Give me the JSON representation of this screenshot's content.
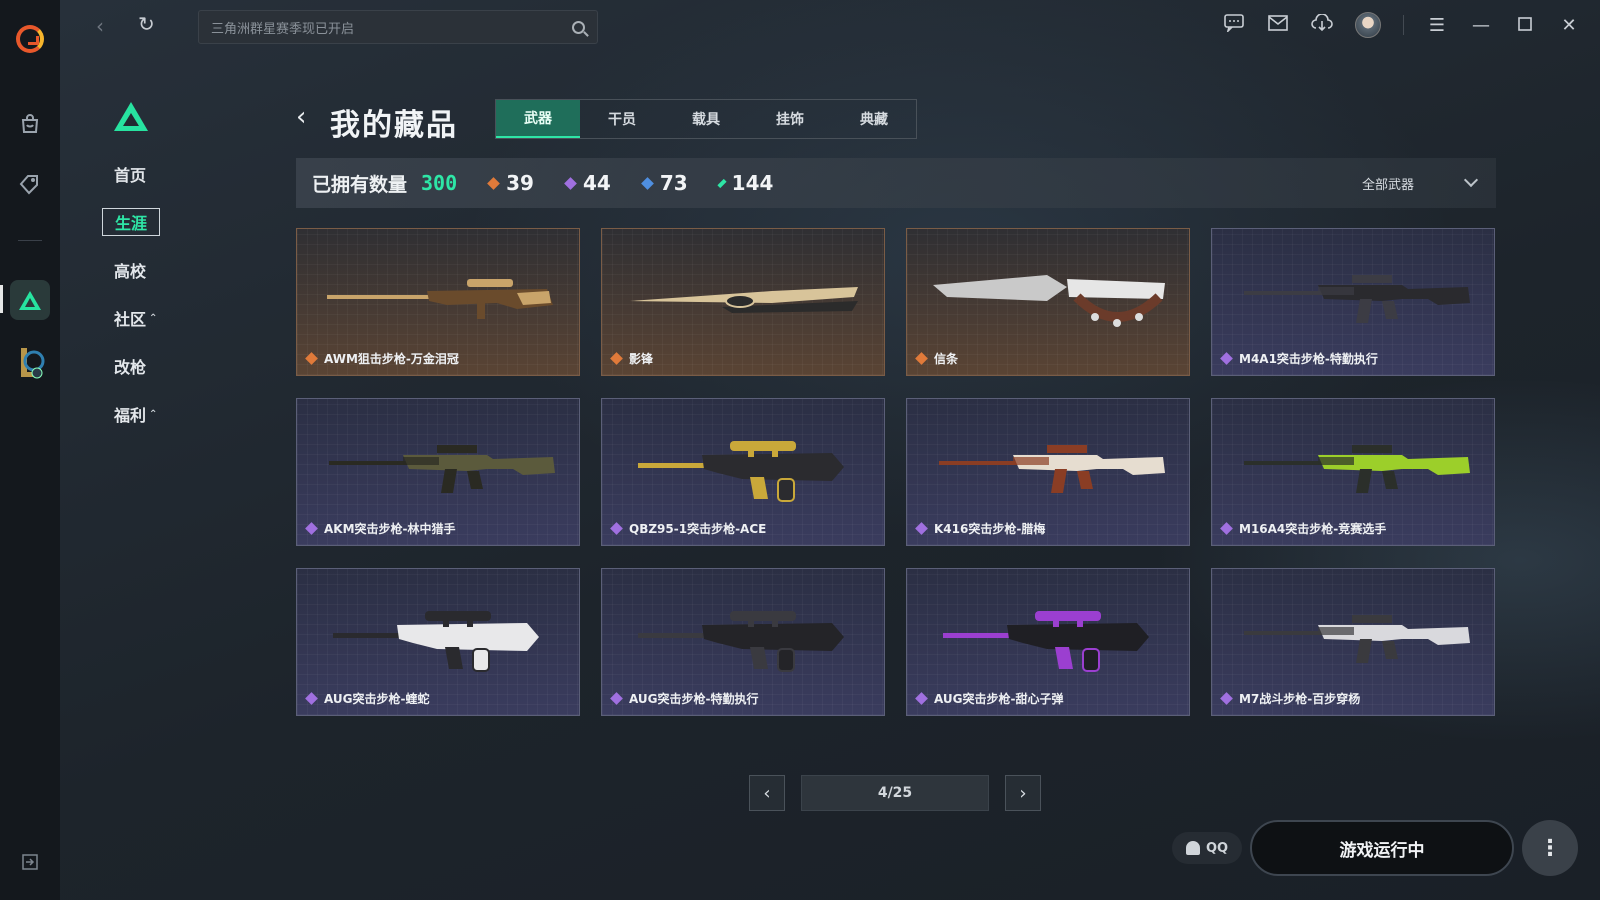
{
  "search": {
    "placeholder": "三角洲群星赛季现已开启"
  },
  "secondary_nav": {
    "items": [
      {
        "label": "首页",
        "caret": ""
      },
      {
        "label": "生涯",
        "caret": ""
      },
      {
        "label": "高校",
        "caret": ""
      },
      {
        "label": "社区",
        "caret": "^"
      },
      {
        "label": "改枪",
        "caret": ""
      },
      {
        "label": "福利",
        "caret": "^"
      }
    ],
    "active_index": 1
  },
  "header": {
    "title": "我的藏品"
  },
  "tabs": [
    "武器",
    "干员",
    "载具",
    "挂饰",
    "典藏"
  ],
  "active_tab": 0,
  "stats": {
    "owned_label": "已拥有数量",
    "owned_value": "300",
    "counts": [
      {
        "value": "39",
        "color": "#e07a3a"
      },
      {
        "value": "44",
        "color": "#a070e0"
      },
      {
        "value": "73",
        "color": "#4f8fe0"
      },
      {
        "value": "144",
        "color": "#2ee6a6"
      }
    ],
    "filter_label": "全部武器"
  },
  "items": [
    {
      "name": "AWM狙击步枪-万金泪冠",
      "rarity": "gold",
      "gem_color": "#e07a3a",
      "gun": "sniper",
      "palette": [
        "#c9a46a",
        "#6a4b2c"
      ]
    },
    {
      "name": "影锋",
      "rarity": "gold",
      "gem_color": "#e07a3a",
      "gun": "blade",
      "palette": [
        "#d8c49a",
        "#2b2b2b"
      ]
    },
    {
      "name": "信条",
      "rarity": "gold",
      "gem_color": "#e07a3a",
      "gun": "knife",
      "palette": [
        "#c9c9c9",
        "#6b3b2a"
      ]
    },
    {
      "name": "M4A1突击步枪-特勤执行",
      "rarity": "purple",
      "gem_color": "#a070e0",
      "gun": "rifle",
      "palette": [
        "#2a2a2e",
        "#3c3c44"
      ]
    },
    {
      "name": "AKM突击步枪-林中猎手",
      "rarity": "purple",
      "gem_color": "#a070e0",
      "gun": "rifle",
      "palette": [
        "#5b5a3c",
        "#2a2a22"
      ]
    },
    {
      "name": "QBZ95-1突击步枪-ACE",
      "rarity": "purple",
      "gem_color": "#a070e0",
      "gun": "bullpup",
      "palette": [
        "#2b2b2f",
        "#c9a83a"
      ]
    },
    {
      "name": "K416突击步枪-腊梅",
      "rarity": "purple",
      "gem_color": "#a070e0",
      "gun": "rifle",
      "palette": [
        "#e6ddd0",
        "#8a3d24"
      ]
    },
    {
      "name": "M16A4突击步枪-竞赛选手",
      "rarity": "purple",
      "gem_color": "#a070e0",
      "gun": "rifle",
      "palette": [
        "#9ccf2a",
        "#2b2f2a"
      ]
    },
    {
      "name": "AUG突击步枪-蝰蛇",
      "rarity": "purple",
      "gem_color": "#a070e0",
      "gun": "bullpup",
      "palette": [
        "#e8e8ea",
        "#2a2a2e"
      ]
    },
    {
      "name": "AUG突击步枪-特勤执行",
      "rarity": "purple",
      "gem_color": "#a070e0",
      "gun": "bullpup",
      "palette": [
        "#242428",
        "#3a3a40"
      ]
    },
    {
      "name": "AUG突击步枪-甜心子弹",
      "rarity": "purple",
      "gem_color": "#a070e0",
      "gun": "bullpup",
      "palette": [
        "#1f1f24",
        "#9b3fd0"
      ]
    },
    {
      "name": "M7战斗步枪-百步穿杨",
      "rarity": "purple",
      "gem_color": "#a070e0",
      "gun": "rifle",
      "palette": [
        "#d9d9dd",
        "#3a3a3e"
      ]
    }
  ],
  "pagination": {
    "current": "4/25"
  },
  "bottom": {
    "qq_label": "QQ",
    "launch_label": "游戏运行中"
  },
  "icons": {
    "rail": [
      "app-logo-icon",
      "bag-icon",
      "tag-icon",
      "delta-force-icon",
      "league-icon",
      "collapse-icon"
    ],
    "top": [
      "chat-icon",
      "mail-icon",
      "download-icon",
      "avatar",
      "menu-icon",
      "minimize-icon",
      "maximize-icon",
      "close-icon"
    ]
  },
  "colors": {
    "accent": "#2ee6a6",
    "gold": "#e07a3a",
    "purple": "#a070e0"
  }
}
